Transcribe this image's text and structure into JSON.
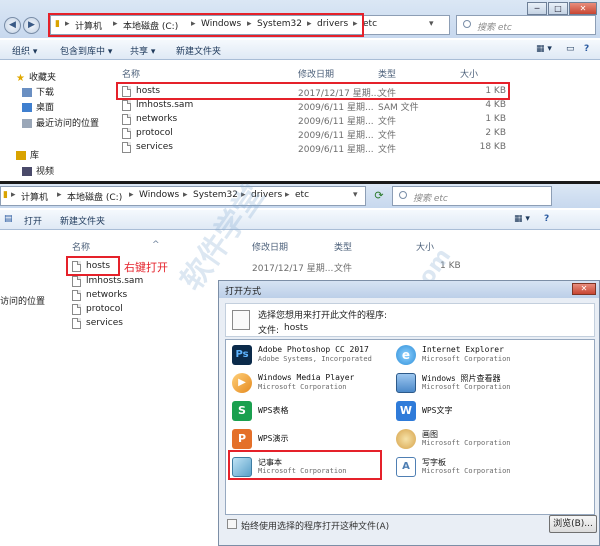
{
  "top_window": {
    "address_parts": [
      "计算机",
      "本地磁盘 (C:)",
      "Windows",
      "System32",
      "drivers",
      "etc"
    ],
    "search_placeholder": "搜索 etc",
    "toolbar": [
      "组织 ▾",
      "包含到库中 ▾",
      "共享 ▾",
      "新建文件夹"
    ],
    "nav_items": [
      {
        "label": "收藏夹",
        "icon": "star-icon"
      },
      {
        "label": "下载",
        "icon": "download-folder-icon"
      },
      {
        "label": "桌面",
        "icon": "desktop-icon"
      },
      {
        "label": "最近访问的位置",
        "icon": "recent-places-icon"
      },
      {
        "label": "库",
        "icon": "library-icon"
      },
      {
        "label": "视频",
        "icon": "video-icon"
      }
    ],
    "columns": [
      "名称",
      "修改日期",
      "类型",
      "大小"
    ],
    "files": [
      {
        "name": "hosts",
        "date": "2017/12/17 星期...",
        "type": "文件",
        "size": "1 KB"
      },
      {
        "name": "lmhosts.sam",
        "date": "2009/6/11 星期...",
        "type": "SAM 文件",
        "size": "4 KB"
      },
      {
        "name": "networks",
        "date": "2009/6/11 星期...",
        "type": "文件",
        "size": "1 KB"
      },
      {
        "name": "protocol",
        "date": "2009/6/11 星期...",
        "type": "文件",
        "size": "2 KB"
      },
      {
        "name": "services",
        "date": "2009/6/11 星期...",
        "type": "文件",
        "size": "18 KB"
      }
    ]
  },
  "bottom_window": {
    "address_parts": [
      "计算机",
      "本地磁盘 (C:)",
      "Windows",
      "System32",
      "drivers",
      "etc"
    ],
    "search_placeholder": "搜索 etc",
    "toolbar": [
      "打开",
      "新建文件夹"
    ],
    "nav_items": [
      {
        "label": "访问的位置"
      }
    ],
    "columns": [
      "名称",
      "修改日期",
      "类型",
      "大小"
    ],
    "files": [
      {
        "name": "hosts",
        "date": "2017/12/17 星期...",
        "type": "文件",
        "size": "1 KB"
      },
      {
        "name": "lmhosts.sam"
      },
      {
        "name": "networks"
      },
      {
        "name": "protocol"
      },
      {
        "name": "services"
      }
    ],
    "annotation": "右键打开"
  },
  "dialog": {
    "title": "打开方式",
    "prompt": "选择您想用来打开此文件的程序:",
    "file_label": "文件:",
    "file_name": "hosts",
    "programs": [
      {
        "name": "Adobe Photoshop CC 2017",
        "corp": "Adobe Systems, Incorporated",
        "icon": "photoshop-icon",
        "color": "#0b2a4a"
      },
      {
        "name": "Internet Explorer",
        "corp": "Microsoft Corporation",
        "icon": "internet-explorer-icon",
        "color": "#2f8fd8"
      },
      {
        "name": "Windows Media Player",
        "corp": "Microsoft Corporation",
        "icon": "media-player-icon",
        "color": "#e58a1f"
      },
      {
        "name": "Windows 照片查看器",
        "corp": "Microsoft Corporation",
        "icon": "photo-viewer-icon",
        "color": "#4c89c9"
      },
      {
        "name": "WPS表格",
        "corp": "",
        "icon": "wps-spreadsheet-icon",
        "color": "#1aa04f"
      },
      {
        "name": "WPS文字",
        "corp": "",
        "icon": "wps-writer-icon",
        "color": "#2f7bd9"
      },
      {
        "name": "WPS演示",
        "corp": "",
        "icon": "wps-presentation-icon",
        "color": "#e4702a"
      },
      {
        "name": "画图",
        "corp": "Microsoft Corporation",
        "icon": "paint-icon",
        "color": "#d6a24a"
      },
      {
        "name": "记事本",
        "corp": "Microsoft Corporation",
        "icon": "notepad-icon",
        "color": "#5aa0c8"
      },
      {
        "name": "写字板",
        "corp": "Microsoft Corporation",
        "icon": "wordpad-icon",
        "color": "#4f7fb3"
      }
    ],
    "checkbox_label": "始终使用选择的程序打开这种文件(A)",
    "browse_label": "浏览(B)..."
  },
  "accent_red": "#e5212a"
}
